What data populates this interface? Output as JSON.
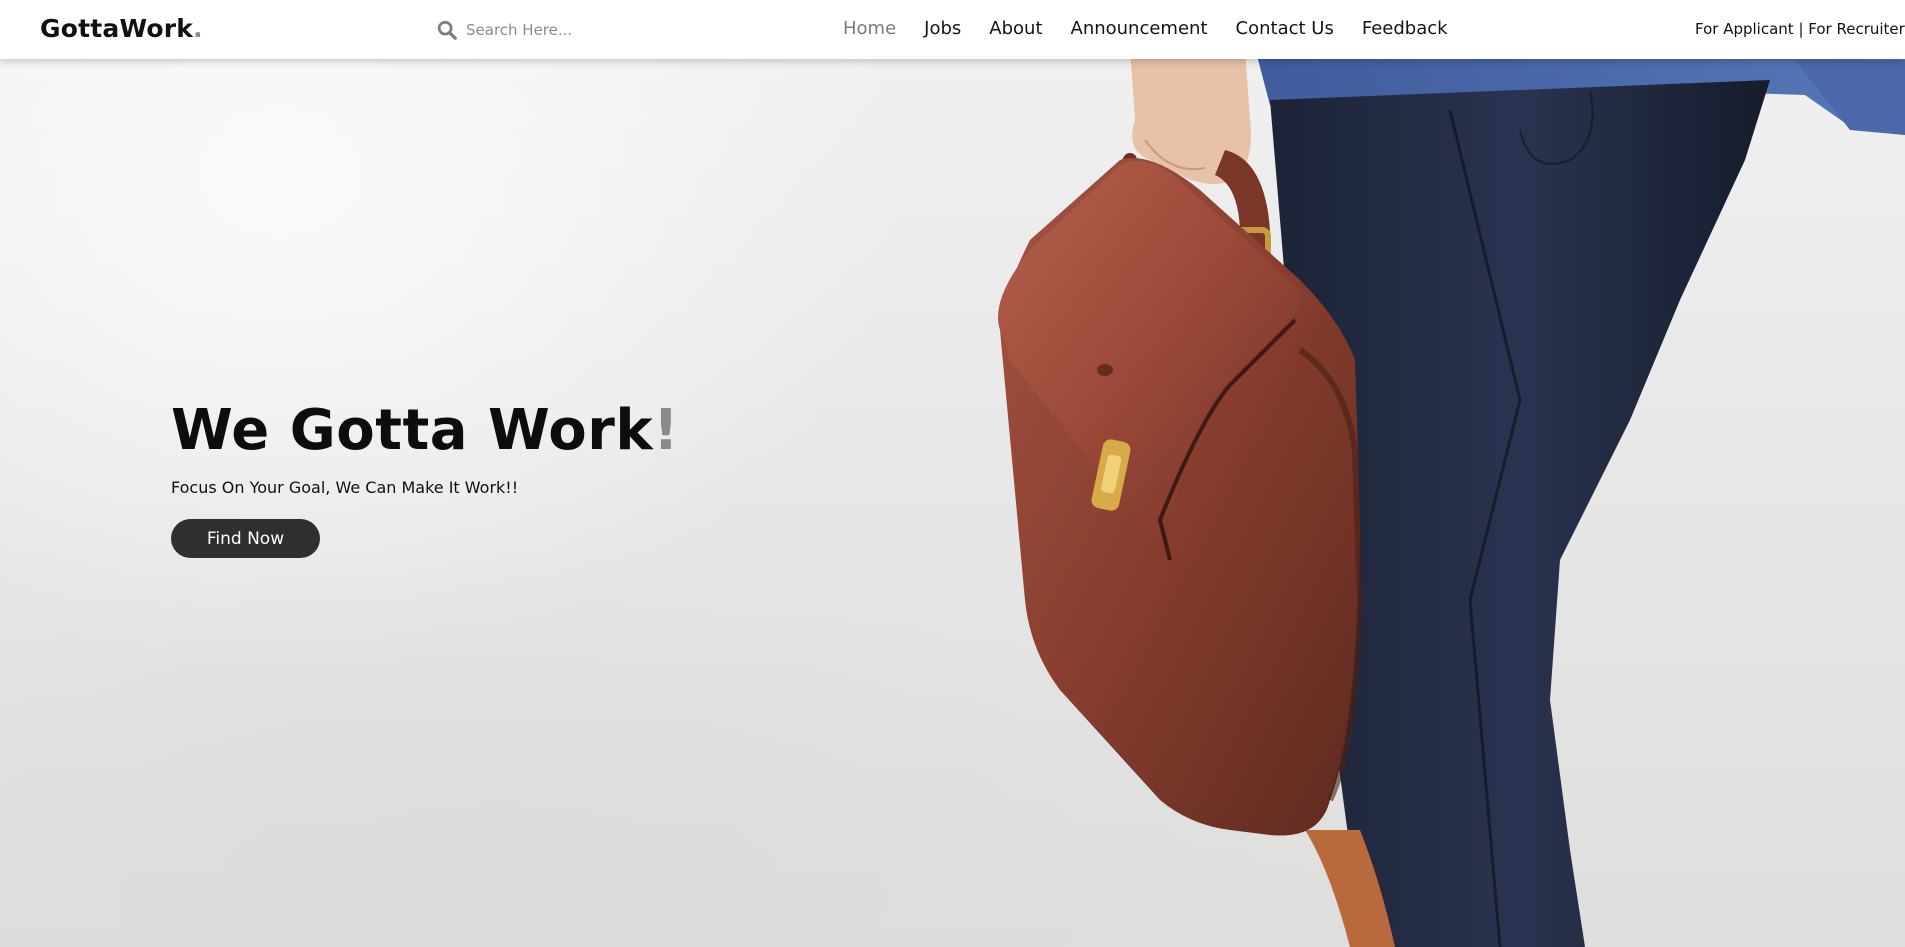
{
  "brand": {
    "name": "GottaWork",
    "dot": "."
  },
  "search": {
    "placeholder": "Search Here..."
  },
  "nav": {
    "items": [
      {
        "label": "Home",
        "active": true
      },
      {
        "label": "Jobs"
      },
      {
        "label": "About"
      },
      {
        "label": "Announcement"
      },
      {
        "label": "Contact Us"
      },
      {
        "label": "Feedback"
      }
    ]
  },
  "portal": {
    "applicant": "For Applicant",
    "separator": " | ",
    "recruiter": "For Recruiter"
  },
  "hero": {
    "title": "We Gotta Work",
    "title_mark": "!",
    "subtitle": "Focus On Your Goal, We Can Make It Work!!",
    "cta_label": "Find Now"
  },
  "icons": {
    "search": "search-icon"
  },
  "colors": {
    "accent": "#8a8a8a",
    "button": "#2f2f2f",
    "active_nav": "#7a7a7a"
  }
}
